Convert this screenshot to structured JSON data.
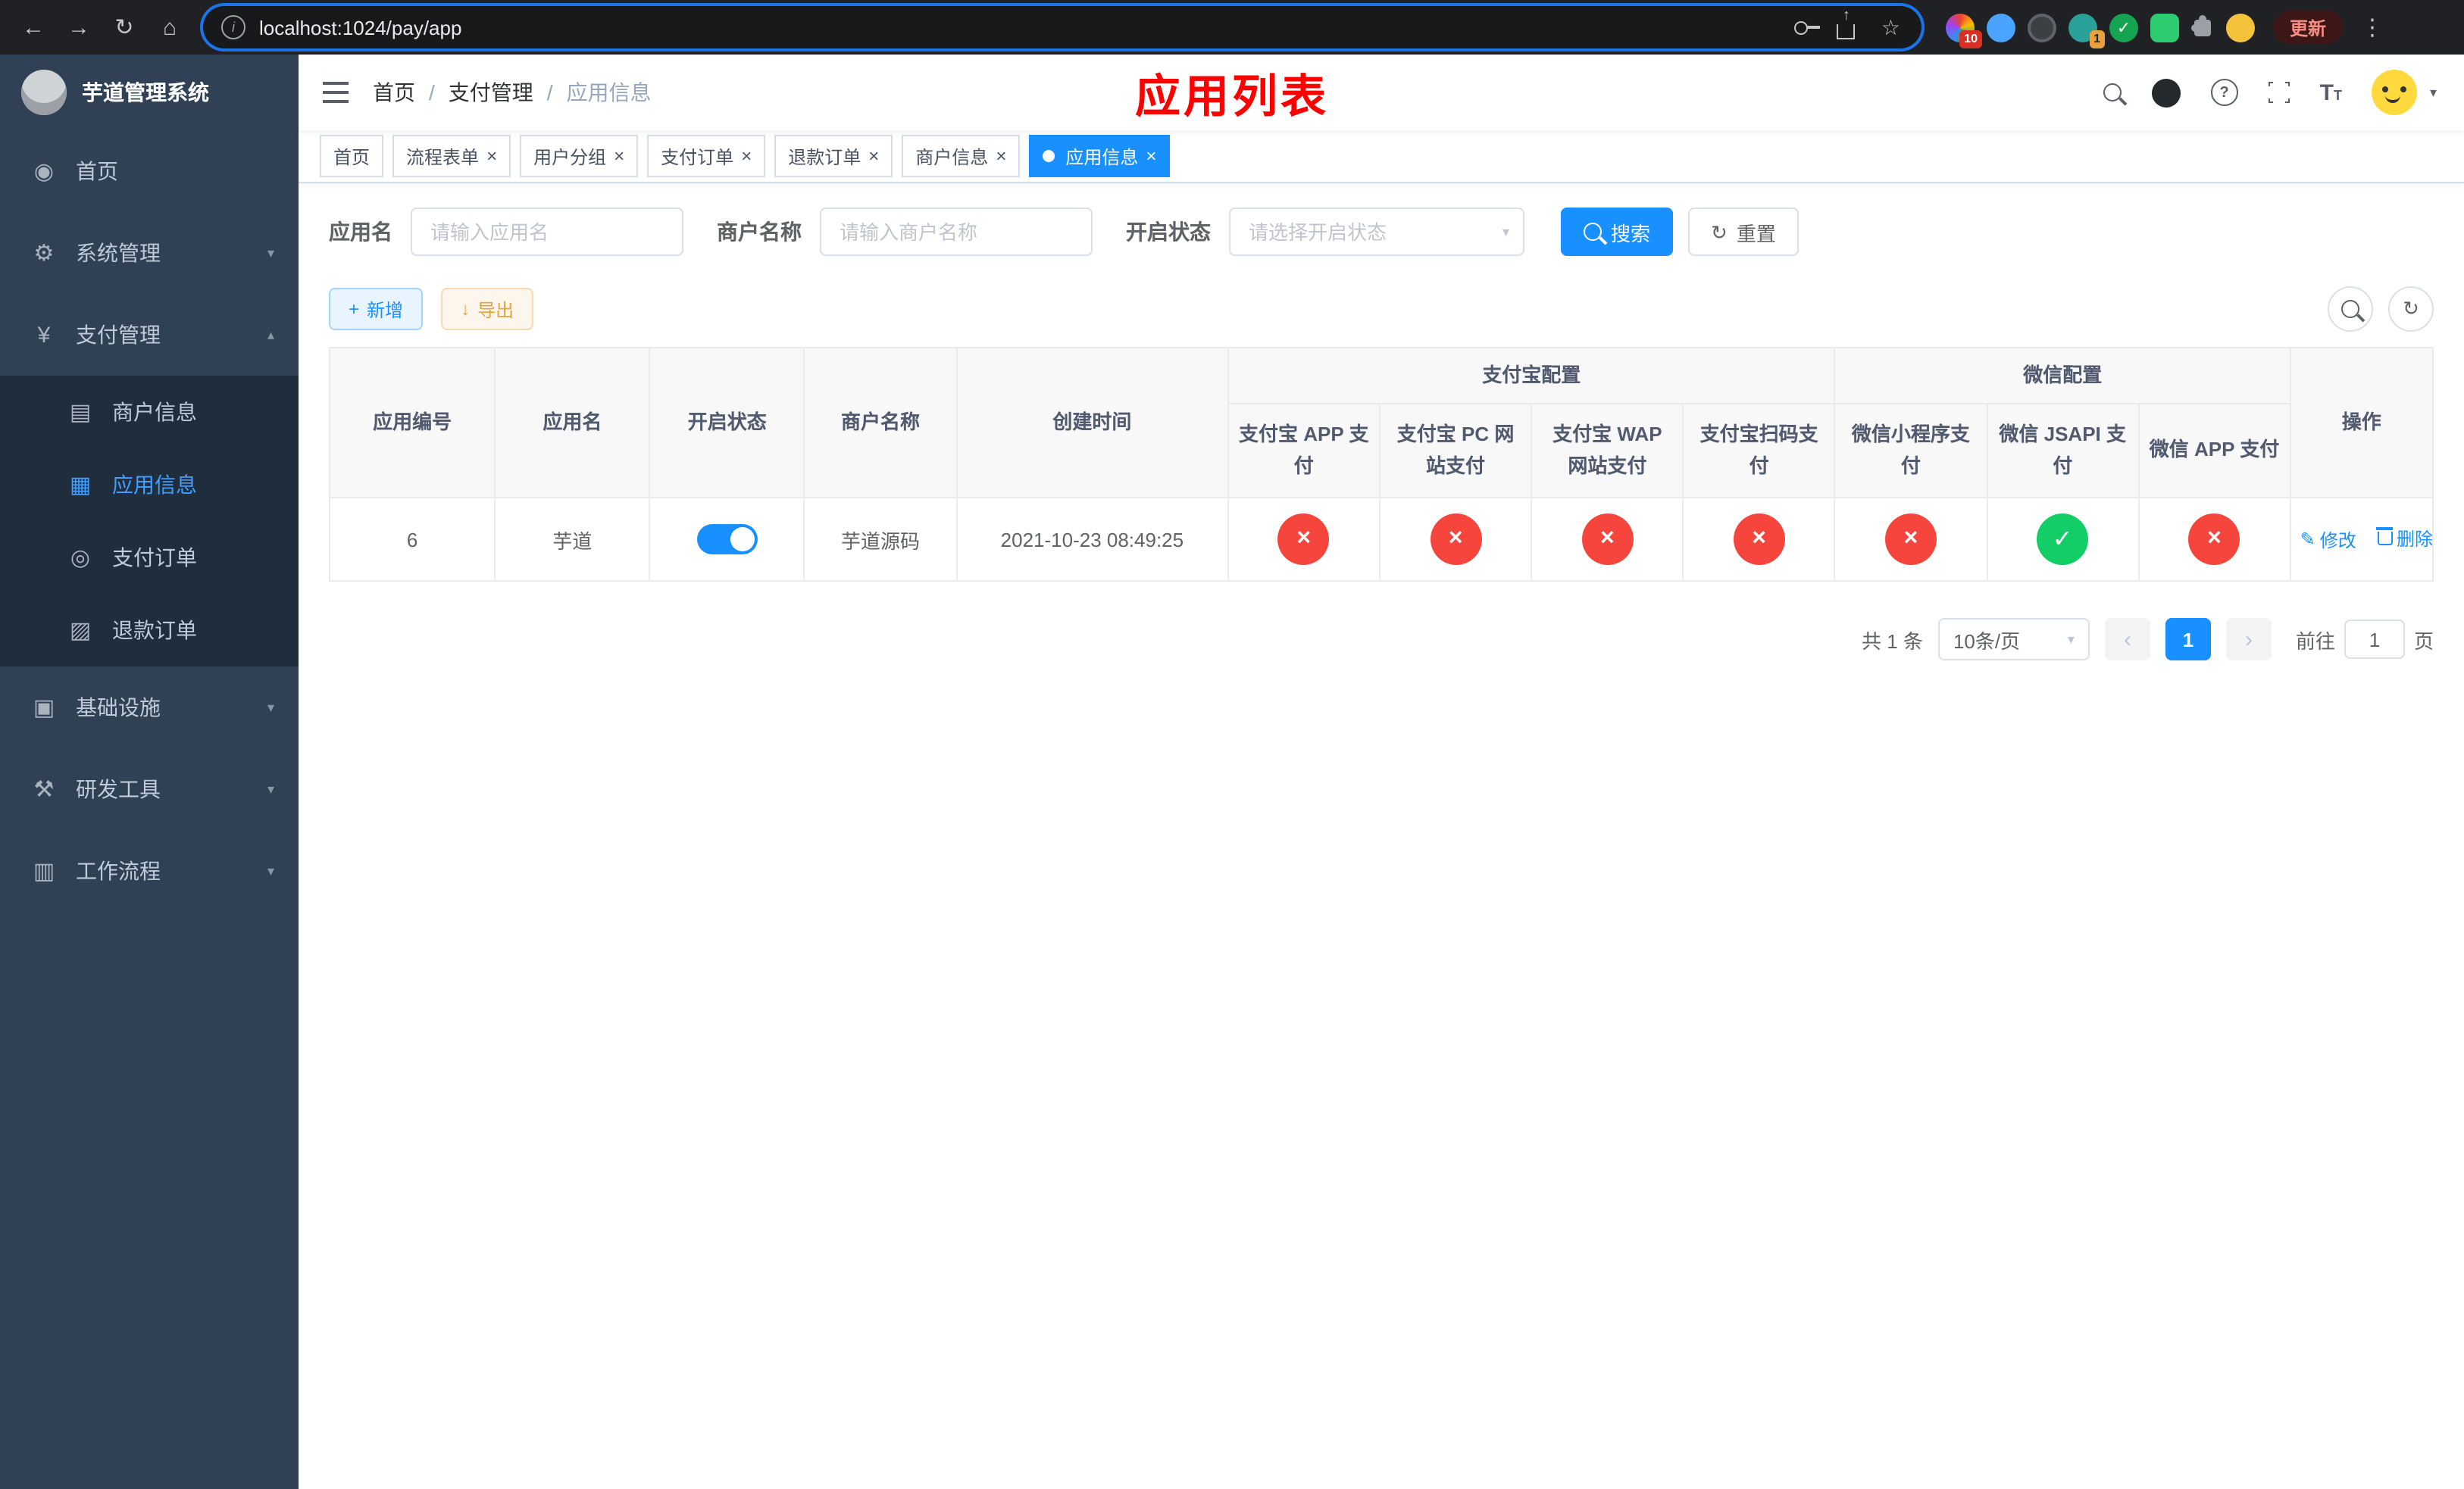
{
  "colors": {
    "accent": "#1890ff",
    "danger": "#f5453d",
    "success": "#13ce66"
  },
  "browser": {
    "url": "localhost:1024/pay/app",
    "update_label": "更新",
    "ext_badge_1": "10",
    "ext_badge_2": "1"
  },
  "sidebar": {
    "title": "芋道管理系统",
    "items": [
      {
        "label": "首页"
      },
      {
        "label": "系统管理"
      },
      {
        "label": "支付管理",
        "children": [
          {
            "label": "商户信息"
          },
          {
            "label": "应用信息"
          },
          {
            "label": "支付订单"
          },
          {
            "label": "退款订单"
          }
        ]
      },
      {
        "label": "基础设施"
      },
      {
        "label": "研发工具"
      },
      {
        "label": "工作流程"
      }
    ]
  },
  "navbar": {
    "breadcrumb": {
      "home": "首页",
      "section": "支付管理",
      "current": "应用信息"
    },
    "page_title": "应用列表"
  },
  "tabs": [
    {
      "label": "首页"
    },
    {
      "label": "流程表单"
    },
    {
      "label": "用户分组"
    },
    {
      "label": "支付订单"
    },
    {
      "label": "退款订单"
    },
    {
      "label": "商户信息"
    },
    {
      "label": "应用信息"
    }
  ],
  "filters": {
    "app_name_label": "应用名",
    "app_name_placeholder": "请输入应用名",
    "merchant_label": "商户名称",
    "merchant_placeholder": "请输入商户名称",
    "status_label": "开启状态",
    "status_placeholder": "请选择开启状态",
    "search_label": "搜索",
    "reset_label": "重置"
  },
  "toolbar": {
    "add_label": "新增",
    "export_label": "导出"
  },
  "table": {
    "columns": {
      "id": "应用编号",
      "name": "应用名",
      "status": "开启状态",
      "merchant": "商户名称",
      "created": "创建时间",
      "actions": "操作"
    },
    "groups": {
      "alipay": "支付宝配置",
      "wechat": "微信配置"
    },
    "alipay_columns": [
      "支付宝 APP 支付",
      "支付宝 PC 网站支付",
      "支付宝 WAP 网站支付",
      "支付宝扫码支付"
    ],
    "wechat_columns": [
      "微信小程序支付",
      "微信 JSAPI 支付",
      "微信 APP 支付"
    ],
    "row": {
      "id": "6",
      "name": "芋道",
      "enabled": true,
      "merchant": "芋道源码",
      "created": "2021-10-23 08:49:25",
      "configs": [
        false,
        false,
        false,
        false,
        false,
        true,
        false
      ],
      "edit_label": "修改",
      "delete_label": "删除"
    }
  },
  "pagination": {
    "total": "共 1 条",
    "page_size": "10条/页",
    "page": "1",
    "goto": "前往",
    "goto_value": "1",
    "unit": "页"
  }
}
